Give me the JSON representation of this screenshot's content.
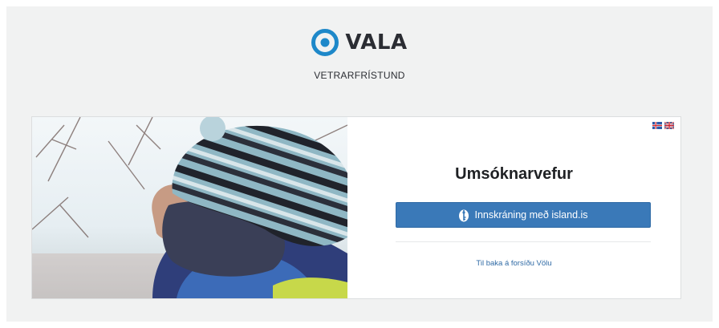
{
  "brand": {
    "name": "VALA",
    "subtitle": "VETRARFRÍSTUND",
    "accent": "#1e88c9"
  },
  "languages": [
    {
      "code": "is",
      "icon": "iceland-flag-icon"
    },
    {
      "code": "en",
      "icon": "uk-flag-icon"
    }
  ],
  "panel": {
    "title": "Umsóknarvefur",
    "login_label": "Innskráning með island.is",
    "login_icon": "island-key-icon",
    "back_link": "Til baka á forsíðu Völu",
    "button_color": "#3a79b8"
  }
}
